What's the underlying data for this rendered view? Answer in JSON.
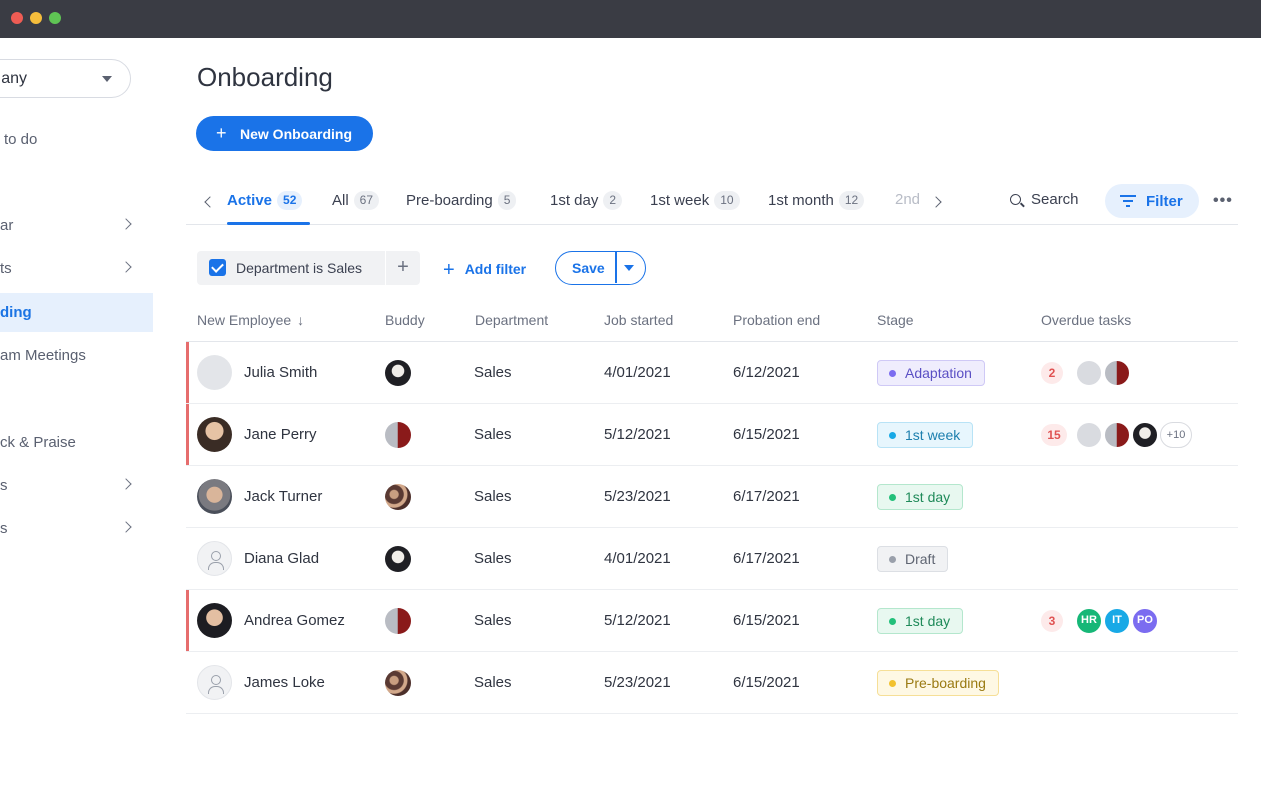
{
  "sidebar": {
    "company_label": "any",
    "items": [
      {
        "label": "to do"
      },
      {
        "label": "ar"
      },
      {
        "label": "ts"
      },
      {
        "label": "ding"
      },
      {
        "label": "am Meetings"
      },
      {
        "label": "ck & Praise"
      },
      {
        "label": "s"
      },
      {
        "label": "s"
      }
    ]
  },
  "page": {
    "title": "Onboarding",
    "new_button_label": "New Onboarding"
  },
  "tabs": [
    {
      "label": "Active",
      "count": "52"
    },
    {
      "label": "All",
      "count": "67"
    },
    {
      "label": "Pre-boarding",
      "count": "5"
    },
    {
      "label": "1st day",
      "count": "2"
    },
    {
      "label": "1st week",
      "count": "10"
    },
    {
      "label": "1st month",
      "count": "12"
    },
    {
      "label": "2nd"
    }
  ],
  "toolbar": {
    "search_label": "Search",
    "filter_label": "Filter",
    "more_label": "•••"
  },
  "filters": {
    "chip_label": "Department is Sales",
    "add_filter_label": "Add filter",
    "save_label": "Save"
  },
  "table": {
    "headers": [
      "New Employee",
      "Buddy",
      "Department",
      "Job started",
      "Probation end",
      "Stage",
      "Overdue tasks"
    ],
    "rows": [
      {
        "name": "Julia Smith",
        "department": "Sales",
        "job_started": "4/01/2021",
        "probation_end": "6/12/2021",
        "stage": "Adaptation",
        "overdue": "2"
      },
      {
        "name": "Jane Perry",
        "department": "Sales",
        "job_started": "5/12/2021",
        "probation_end": "6/15/2021",
        "stage": "1st week",
        "overdue": "15",
        "more": "+10"
      },
      {
        "name": "Jack Turner",
        "department": "Sales",
        "job_started": "5/23/2021",
        "probation_end": "6/17/2021",
        "stage": "1st day"
      },
      {
        "name": "Diana Glad",
        "department": "Sales",
        "job_started": "4/01/2021",
        "probation_end": "6/17/2021",
        "stage": "Draft"
      },
      {
        "name": "Andrea Gomez",
        "department": "Sales",
        "job_started": "5/12/2021",
        "probation_end": "6/15/2021",
        "stage": "1st day",
        "overdue": "3",
        "assignees": [
          "HR",
          "IT",
          "PO"
        ]
      },
      {
        "name": "James Loke",
        "department": "Sales",
        "job_started": "5/23/2021",
        "probation_end": "6/15/2021",
        "stage": "Pre-boarding"
      }
    ]
  },
  "colors": {
    "accent": "#1a73e8",
    "overdue_flag": "#e66d6d",
    "stage_adaptation": "#7b6cf0",
    "stage_week": "#18a9e6",
    "stage_day": "#22c07a",
    "stage_draft": "#9aa0ab",
    "stage_preboarding": "#f2c12e",
    "badge_hr": "#16b777",
    "badge_it": "#18a9e6",
    "badge_po": "#7b6cf0"
  }
}
